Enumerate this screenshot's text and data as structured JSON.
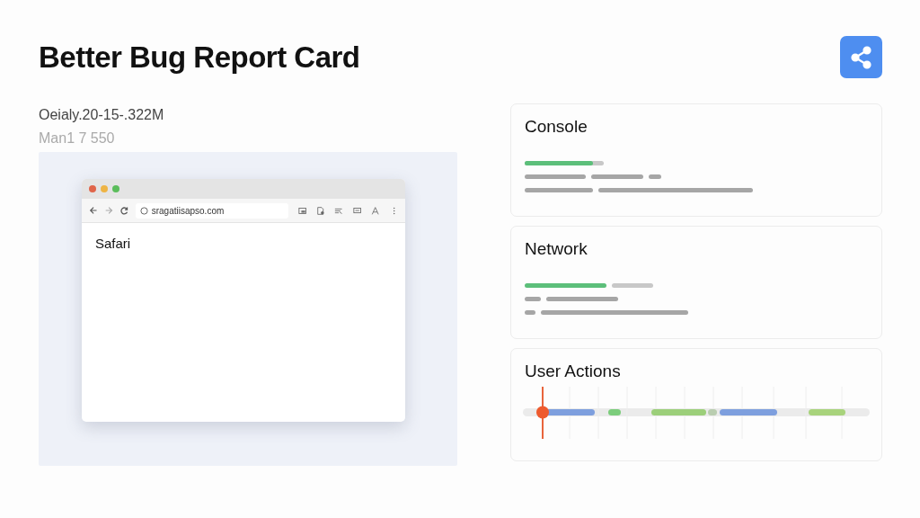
{
  "title": "Better Bug Report Card",
  "meta": [
    "Oeialy.20-15-.322M",
    "Man1 7 550"
  ],
  "screenshot": {
    "url": "sragatiisapso.com",
    "page_title": "Safari"
  },
  "panels": [
    {
      "kind": "log",
      "title": "Console"
    },
    {
      "kind": "network",
      "title": "Network"
    },
    {
      "kind": "timeline",
      "title": "User Actions"
    }
  ]
}
